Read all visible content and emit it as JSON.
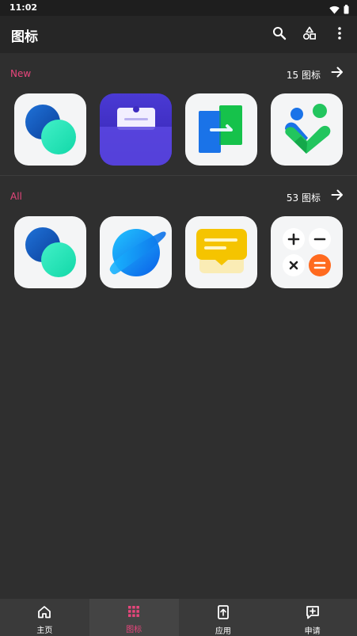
{
  "status_bar": {
    "time": "11:02",
    "icons": [
      "wifi-icon",
      "battery-icon"
    ]
  },
  "app_bar": {
    "title": "图标",
    "actions": [
      "search-icon",
      "shapes-icon",
      "more-vert-icon"
    ]
  },
  "sections": [
    {
      "name": "New",
      "count_label": "15 图标",
      "icons": [
        "circles-app-icon",
        "purple-folder-app-icon",
        "transfer-app-icon",
        "family-heart-app-icon"
      ]
    },
    {
      "name": "All",
      "count_label": "53 图标",
      "icons": [
        "circles-app-icon",
        "planet-browser-app-icon",
        "yellow-message-app-icon",
        "calculator-app-icon"
      ]
    }
  ],
  "bottom_nav": [
    {
      "label": "主页",
      "icon": "home-icon",
      "active": false
    },
    {
      "label": "图标",
      "icon": "grid-icon",
      "active": true
    },
    {
      "label": "应用",
      "icon": "app-upload-icon",
      "active": false
    },
    {
      "label": "申请",
      "icon": "add-request-icon",
      "active": false
    }
  ],
  "colors": {
    "accent": "#e8467c",
    "background": "#2f2f2f",
    "app_bar": "#262626",
    "nav_bar": "#3a3a3a"
  }
}
